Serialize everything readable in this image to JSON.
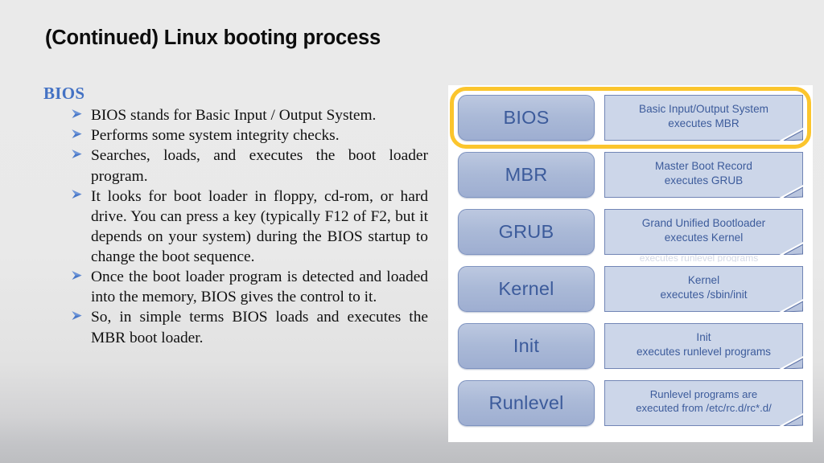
{
  "slide": {
    "title": "(Continued) Linux booting process"
  },
  "content": {
    "heading": "BIOS",
    "bullets": [
      "BIOS stands for Basic Input / Output System.",
      "Performs some system integrity checks.",
      "Searches, loads, and executes the boot loader program.",
      "It looks for boot loader in floppy, cd-rom, or hard drive. You can press a key (typically F12 of F2, but it depends on your system) during the BIOS startup to change the boot sequence.",
      "Once the boot loader program is detected and loaded into the memory, BIOS gives the control to it.",
      "So, in simple terms BIOS loads and executes the MBR boot loader."
    ]
  },
  "diagram": {
    "rows": [
      {
        "stage": "BIOS",
        "note": "Basic Input/Output System\nexecutes MBR",
        "highlighted": true
      },
      {
        "stage": "MBR",
        "note": "Master Boot Record\nexecutes GRUB",
        "highlighted": false
      },
      {
        "stage": "GRUB",
        "note": "Grand Unified Bootloader\nexecutes Kernel",
        "highlighted": false,
        "artifact": "executes runlevel programs"
      },
      {
        "stage": "Kernel",
        "note": "Kernel\nexecutes /sbin/init",
        "highlighted": false
      },
      {
        "stage": "Init",
        "note": "Init\nexecutes runlevel programs",
        "highlighted": false
      },
      {
        "stage": "Runlevel",
        "note": "Runlevel programs are\nexecuted from /etc/rc.d/rc*.d/",
        "highlighted": false
      }
    ]
  },
  "colors": {
    "accent_blue": "#4472c4",
    "label_blue": "#3c5b9b",
    "stage_fill": "#aab9d7",
    "note_fill": "#ccd6e9",
    "highlight_yellow": "#fbc52d",
    "page_bg": "#e9e9e9",
    "panel_bg": "#ffffff"
  }
}
